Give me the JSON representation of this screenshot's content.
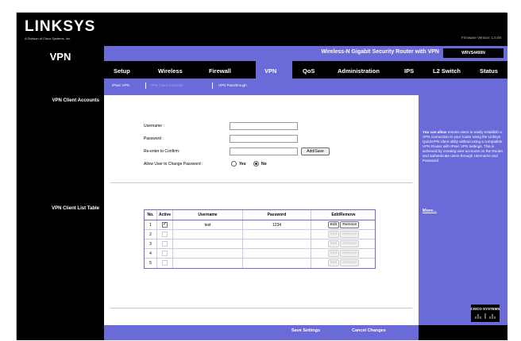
{
  "brand": {
    "logo": "LINKSYS",
    "tagline": "A Division of Cisco Systems, Inc.",
    "firmware": "Firmware Version: 1.0.00"
  },
  "product": {
    "name": "Wireless-N Gigabit Security Router with VPN",
    "model": "WRVS4400N"
  },
  "section_title": "VPN",
  "nav": {
    "tabs": [
      "Setup",
      "Wireless",
      "Firewall",
      "VPN",
      "QoS",
      "Administration",
      "IPS",
      "L2 Switch",
      "Status"
    ],
    "active_tab": "VPN",
    "subtabs": [
      "IPsec VPN",
      "VPN Client Accounts",
      "VPN Passthrough"
    ],
    "active_subtab": "VPN Client Accounts"
  },
  "left_labels": {
    "accounts": "VPN Client Accounts",
    "list_table": "VPN Client List Table"
  },
  "form": {
    "username_label": "Username :",
    "username_value": "",
    "password_label": "Password :",
    "password_value": "",
    "confirm_label": "Re-enter to Confirm:",
    "confirm_value": "",
    "add_button": "Add/Save",
    "allow_change_label": "Allow User to Change Password :",
    "yes_label": "Yes",
    "no_label": "No",
    "allow_change_selected": "No"
  },
  "table": {
    "headers": [
      "No.",
      "Active",
      "Username",
      "Password",
      "Edit/Remove"
    ],
    "edit_label": "Edit",
    "remove_label": "Remove",
    "rows": [
      {
        "no": "1",
        "active": true,
        "username": "test",
        "password": "1234",
        "enabled": true
      },
      {
        "no": "2",
        "active": false,
        "username": "",
        "password": "",
        "enabled": false
      },
      {
        "no": "3",
        "active": false,
        "username": "",
        "password": "",
        "enabled": false
      },
      {
        "no": "4",
        "active": false,
        "username": "",
        "password": "",
        "enabled": false
      },
      {
        "no": "5",
        "active": false,
        "username": "",
        "password": "",
        "enabled": false
      }
    ]
  },
  "help": {
    "lead": "You can allow",
    "text": "remote users to easily establish a VPN connection to your router using the Linksys QuickVPN client utility without using a compatible VPN Router with IPsec VPN settings. This is achieved by creating user accounts on the Router and authenticate users through Username and Password.",
    "more": "More..."
  },
  "footer": {
    "save": "Save Settings",
    "cancel": "Cancel Changes",
    "cisco": "CISCO SYSTEMS"
  },
  "colors": {
    "accent": "#6a6ad8",
    "dark": "#000000"
  }
}
